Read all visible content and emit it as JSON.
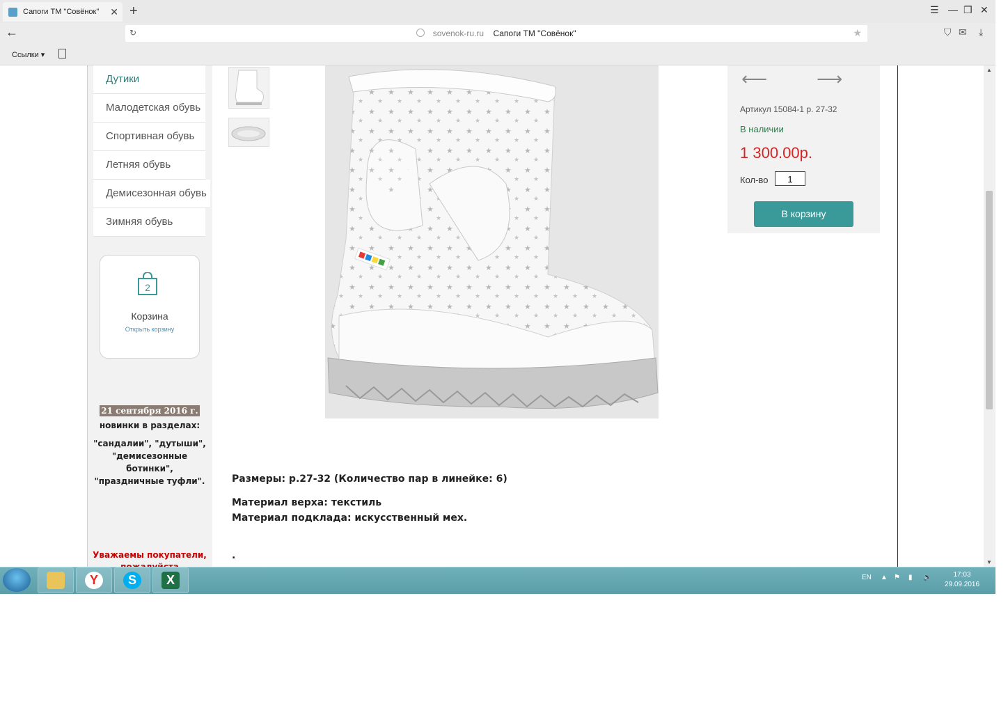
{
  "browser": {
    "tab_title": "Сапоги ТМ \"Совёнок\"",
    "tab_close": "✕",
    "new_tab": "+",
    "domain": "sovenok-ru.ru",
    "page_title": "Сапоги ТМ \"Совёнок\"",
    "bookmarks_label": "Ссылки ▾"
  },
  "sidebar": {
    "items": [
      {
        "label": "Дутики"
      },
      {
        "label": "Малодетская обувь"
      },
      {
        "label": "Спортивная обувь"
      },
      {
        "label": "Летняя обувь"
      },
      {
        "label": "Демисезонная обувь"
      },
      {
        "label": "Зимняя обувь"
      }
    ],
    "cart": {
      "count": "2",
      "title": "Корзина",
      "link": "Открыть корзину"
    },
    "news": {
      "date": "21 сентября 2016 г.",
      "line1": "новинки в разделах:",
      "line2": "\"сандалии\", \"дутыши\",",
      "line3": "\"демисезонные",
      "line4": "ботинки\",",
      "line5": "\"праздничные туфли\"."
    },
    "notice": {
      "line1": "Уважаемы покупатели,",
      "line2": "пожалуйста"
    }
  },
  "product": {
    "sku": "Артикул 15084-1 р. 27-32",
    "stock": "В наличии",
    "price": "1 300.00р.",
    "qty_label": "Кол-во",
    "qty_value": "1",
    "add_to_cart": "В корзину",
    "prev_arrow": "⟵",
    "next_arrow": "⟶",
    "desc_sizes": "Размеры: р.27-32 (Количество пар в линейке: 6)",
    "desc_top": "Материал верха: текстиль",
    "desc_lining": "Материал подклада: искусственный мех.",
    "desc_dot": "."
  },
  "taskbar": {
    "lang": "EN",
    "time": "17:03",
    "date": "29.09.2016",
    "app_yandex": "Y",
    "app_skype": "S",
    "app_excel": "X"
  },
  "colors": {
    "accent": "#3a9a9a",
    "price": "#d42525",
    "stock": "#2a7a4a",
    "notice": "#cc0000"
  }
}
